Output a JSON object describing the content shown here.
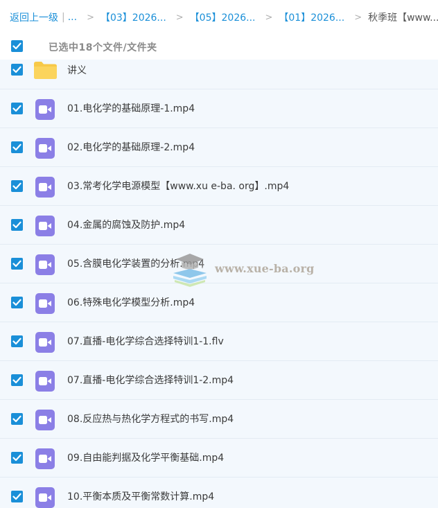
{
  "breadcrumb": {
    "back_label": "返回上一级",
    "separator_bar": "|",
    "ellipsis": "...",
    "separator": ">",
    "items": [
      "【03】2026...",
      "【05】2026...",
      "【01】2026..."
    ],
    "current": "秋季班【www...."
  },
  "selection": {
    "checked": true,
    "text": "已选中18个文件/文件夹"
  },
  "files": [
    {
      "name": "讲义",
      "type": "folder",
      "checked": true
    },
    {
      "name": "01.电化学的基础原理-1.mp4",
      "type": "video",
      "checked": true
    },
    {
      "name": "02.电化学的基础原理-2.mp4",
      "type": "video",
      "checked": true
    },
    {
      "name": "03.常考化学电源模型【www.xu e-ba. org】.mp4",
      "type": "video",
      "checked": true
    },
    {
      "name": "04.金属的腐蚀及防护.mp4",
      "type": "video",
      "checked": true
    },
    {
      "name": "05.含膜电化学装置的分析.mp4",
      "type": "video",
      "checked": true
    },
    {
      "name": "06.特殊电化学模型分析.mp4",
      "type": "video",
      "checked": true
    },
    {
      "name": "07.直播-电化学综合选择特训1-1.flv",
      "type": "video",
      "checked": true
    },
    {
      "name": "07.直播-电化学综合选择特训1-2.mp4",
      "type": "video",
      "checked": true
    },
    {
      "name": "08.反应热与热化学方程式的书写.mp4",
      "type": "video",
      "checked": true
    },
    {
      "name": "09.自由能判据及化学平衡基础.mp4",
      "type": "video",
      "checked": true
    },
    {
      "name": "10.平衡本质及平衡常数计算.mp4",
      "type": "video",
      "checked": true
    }
  ],
  "watermark": {
    "text": "www.xue-ba.org",
    "icon": "graduation-cap-books-logo"
  },
  "colors": {
    "accent": "#1a8fd8",
    "row_bg": "#f3f8fd",
    "video_icon": "#8b7fe6",
    "folder_icon": "#f7c948"
  }
}
